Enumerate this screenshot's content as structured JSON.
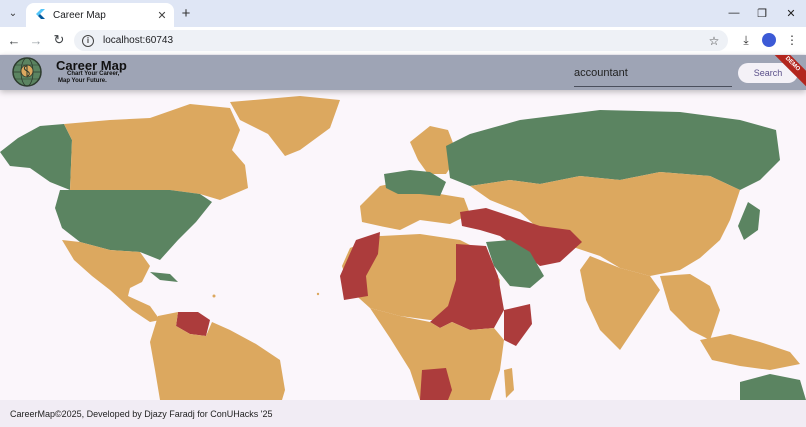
{
  "browser": {
    "tab_title": "Career Map",
    "url": "localhost:60743",
    "icons": [
      "tab-search-icon",
      "flutter-favicon-icon",
      "close-icon",
      "plus-icon",
      "minimize-icon",
      "restore-icon",
      "close-window-icon",
      "back-icon",
      "forward-icon",
      "reload-icon",
      "info-icon",
      "star-icon",
      "download-icon",
      "profile-icon",
      "kebab-menu-icon"
    ]
  },
  "header": {
    "title": "Career Map",
    "tagline_line1": "Chart Your Career,",
    "tagline_line2": "Map Your Future.",
    "search_value": "accountant",
    "search_button": "Search",
    "ribbon": "DEMO",
    "background_color": "#9ea4b5"
  },
  "map": {
    "legend_colors": {
      "green": "#5b8461",
      "yellow": "#dca85f",
      "red": "#ac3c3c"
    }
  },
  "footer": {
    "text": "CareerMap©2025, Developed by Djazy Faradj for ConUHacks '25"
  }
}
